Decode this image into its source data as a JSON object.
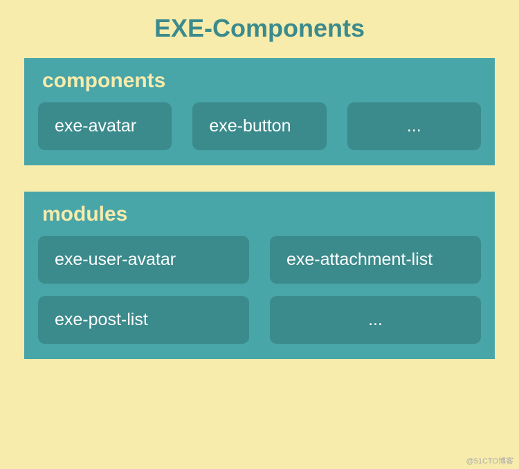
{
  "title": "EXE-Components",
  "sections": {
    "components": {
      "header": "components",
      "items": [
        "exe-avatar",
        "exe-button",
        "..."
      ]
    },
    "modules": {
      "header": "modules",
      "row1": [
        "exe-user-avatar",
        "exe-attachment-list"
      ],
      "row2": [
        "exe-post-list",
        "..."
      ]
    }
  },
  "watermark": "@51CTO博客"
}
